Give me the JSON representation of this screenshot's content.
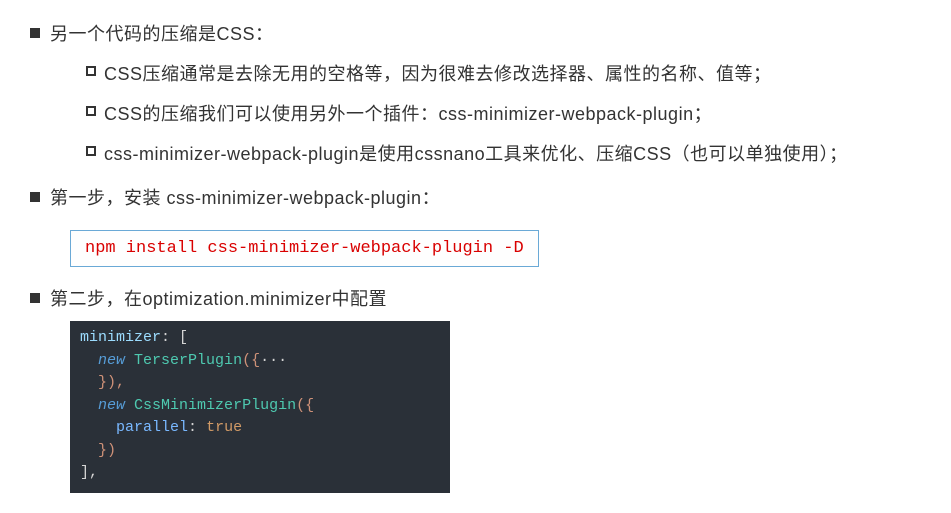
{
  "section1": {
    "title": "另一个代码的压缩是CSS：",
    "sub1": "CSS压缩通常是去除无用的空格等，因为很难去修改选择器、属性的名称、值等；",
    "sub2": "CSS的压缩我们可以使用另外一个插件：css-minimizer-webpack-plugin；",
    "sub3": "css-minimizer-webpack-plugin是使用cssnano工具来优化、压缩CSS（也可以单独使用）；"
  },
  "section2": {
    "title": "第一步，安装 css-minimizer-webpack-plugin：",
    "command": "npm install css-minimizer-webpack-plugin -D"
  },
  "section3": {
    "title": "第二步，在optimization.minimizer中配置",
    "code": {
      "l1_key": "minimizer",
      "l1_colon_open": ": [",
      "l2_new": "new",
      "l2_class": "TerserPlugin",
      "l2_open": "({",
      "l2_dots": "···",
      "l3_close": "}),",
      "l4_new": "new",
      "l4_class": "CssMinimizerPlugin",
      "l4_open": "({",
      "l5_prop": "parallel",
      "l5_colon": ":",
      "l5_val": "true",
      "l6_close": "})",
      "l7_close": "],"
    }
  }
}
